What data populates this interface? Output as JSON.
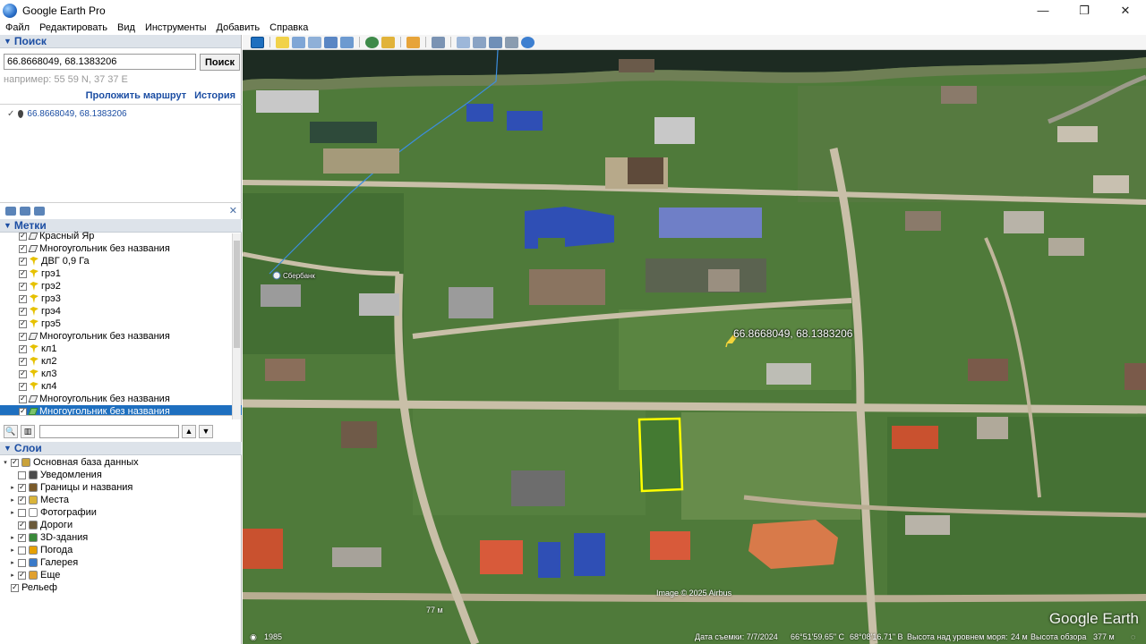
{
  "window": {
    "title": "Google Earth Pro",
    "minimize": "—",
    "maximize": "❐",
    "close": "✕"
  },
  "menu": [
    "Файл",
    "Редактировать",
    "Вид",
    "Инструменты",
    "Добавить",
    "Справка"
  ],
  "search": {
    "header": "Поиск",
    "value": "66.8668049, 68.1383206",
    "button": "Поиск",
    "example": "например: 55 59 N, 37 37 E",
    "route_link": "Проложить маршрут",
    "history_link": "История",
    "result": "66.8668049, 68.1383206"
  },
  "places": {
    "header": "Метки",
    "items": [
      {
        "label": "Красный Яр",
        "icon": "polygon-icon",
        "checked": true
      },
      {
        "label": "Многоугольник без названия",
        "icon": "polygon-icon",
        "checked": true
      },
      {
        "label": "ДВГ 0,9 Га",
        "icon": "pushpin-icon",
        "checked": true
      },
      {
        "label": "грэ1",
        "icon": "pushpin-icon",
        "checked": true
      },
      {
        "label": "грэ2",
        "icon": "pushpin-icon",
        "checked": true
      },
      {
        "label": "грэ3",
        "icon": "pushpin-icon",
        "checked": true
      },
      {
        "label": "грэ4",
        "icon": "pushpin-icon",
        "checked": true
      },
      {
        "label": "грэ5",
        "icon": "pushpin-icon",
        "checked": true
      },
      {
        "label": "Многоугольник без названия",
        "icon": "polygon-icon",
        "checked": true
      },
      {
        "label": "кл1",
        "icon": "pushpin-icon",
        "checked": true
      },
      {
        "label": "кл2",
        "icon": "pushpin-icon",
        "checked": true
      },
      {
        "label": "кл3",
        "icon": "pushpin-icon",
        "checked": true
      },
      {
        "label": "кл4",
        "icon": "pushpin-icon",
        "checked": true
      },
      {
        "label": "Многоугольник без названия",
        "icon": "polygon-icon",
        "checked": true
      },
      {
        "label": "Многоугольник без названия",
        "icon": "polygon-green-icon",
        "checked": true,
        "selected": true
      }
    ]
  },
  "layers": {
    "header": "Слои",
    "items": [
      {
        "label": "Основная база данных",
        "expander": "▾",
        "checked": true,
        "color": "#c9a23a",
        "level": 0
      },
      {
        "label": "Уведомления",
        "expander": "",
        "checked": false,
        "color": "#4a4a4a",
        "level": 1
      },
      {
        "label": "Границы и названия",
        "expander": "▸",
        "checked": true,
        "color": "#7a5a2a",
        "level": 1
      },
      {
        "label": "Места",
        "expander": "▸",
        "checked": true,
        "color": "#d9b43a",
        "level": 1
      },
      {
        "label": "Фотографии",
        "expander": "▸",
        "checked": false,
        "color": "#ffffff",
        "level": 1
      },
      {
        "label": "Дороги",
        "expander": "",
        "checked": true,
        "color": "#6b5a3a",
        "level": 1
      },
      {
        "label": "3D-здания",
        "expander": "▸",
        "checked": true,
        "color": "#3a8a3a",
        "level": 1
      },
      {
        "label": "Погода",
        "expander": "▸",
        "checked": false,
        "color": "#e6a000",
        "level": 1
      },
      {
        "label": "Галерея",
        "expander": "▸",
        "checked": false,
        "color": "#3a7ac9",
        "level": 1
      },
      {
        "label": "Еще",
        "expander": "▸",
        "checked": true,
        "color": "#e0a030",
        "level": 1
      },
      {
        "label": "Рельеф",
        "expander": "",
        "checked": true,
        "color": "",
        "level": 0
      }
    ]
  },
  "map": {
    "placemark_label": "66.8668049, 68.1383206",
    "street_label": "Сбербанк",
    "credit": "Image © 2025 Airbus",
    "scale": "77 м",
    "watermark": "Google Earth",
    "status": {
      "year": "1985",
      "date": "Дата съемки: 7/7/2024",
      "lat": "66°51'59.65\" С",
      "lon": "68°08'16.71\" В",
      "altitude": "Высота над уровнем моря:",
      "alt_value": "24 м",
      "eye_label": "Высота обзора",
      "eye_value": "377 м"
    },
    "colors": {
      "polygon": "#ffff00",
      "river": "#1d2b22",
      "grass": "#4f7a3a",
      "road": "#c9bfa8"
    }
  }
}
